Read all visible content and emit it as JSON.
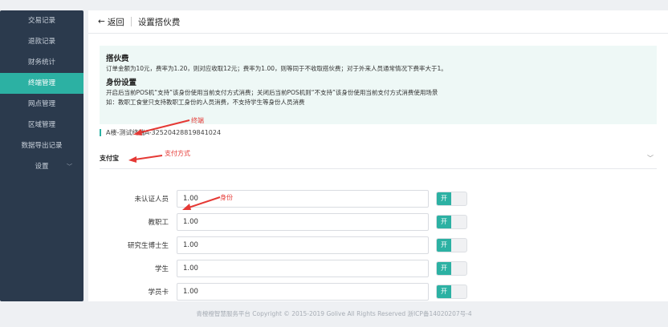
{
  "sidebar": {
    "items": [
      {
        "label": "交易记录"
      },
      {
        "label": "退款记录"
      },
      {
        "label": "财务统计"
      },
      {
        "label": "终端管理"
      },
      {
        "label": "网点管理"
      },
      {
        "label": "区域管理"
      },
      {
        "label": "数据导出记录"
      },
      {
        "label": "设置"
      }
    ],
    "active": "终端管理"
  },
  "header": {
    "back_label": "返回",
    "title": "设置搭伙费"
  },
  "notice": {
    "h1": "搭伙费",
    "t1": "订单金额为10元，费率为1.20，则对应收取12元；费率为1.00，则等同于不收取搭伙费；对于外来人员通常情况下费率大于1。",
    "h2": "身份设置",
    "t2": "开启后当前POS机“支持”该身份使用当前支付方式消费；关闭后当前POS机则“不支持”该身份使用当前支付方式消费使用场景",
    "t3": "如：教职工食堂只支持教职工身份的人员消费，不支持学生等身份人员消费"
  },
  "terminal": {
    "label": "A楼-测试终端A-32520428819841024"
  },
  "payment": {
    "label": "支付宝"
  },
  "rows": [
    {
      "label": "未认证人员",
      "value": "1.00",
      "toggle": "开"
    },
    {
      "label": "教职工",
      "value": "1.00",
      "toggle": "开"
    },
    {
      "label": "研究生博士生",
      "value": "1.00",
      "toggle": "开"
    },
    {
      "label": "学生",
      "value": "1.00",
      "toggle": "开"
    },
    {
      "label": "学员卡",
      "value": "1.00",
      "toggle": "开"
    }
  ],
  "annotations": {
    "terminal": "终端",
    "payment": "支付方式",
    "identity": "身份"
  },
  "footer": "青橙橙智慧服务平台 Copyright © 2015-2019 Golive All Rights Reserved 浙ICP备14020207号-4"
}
